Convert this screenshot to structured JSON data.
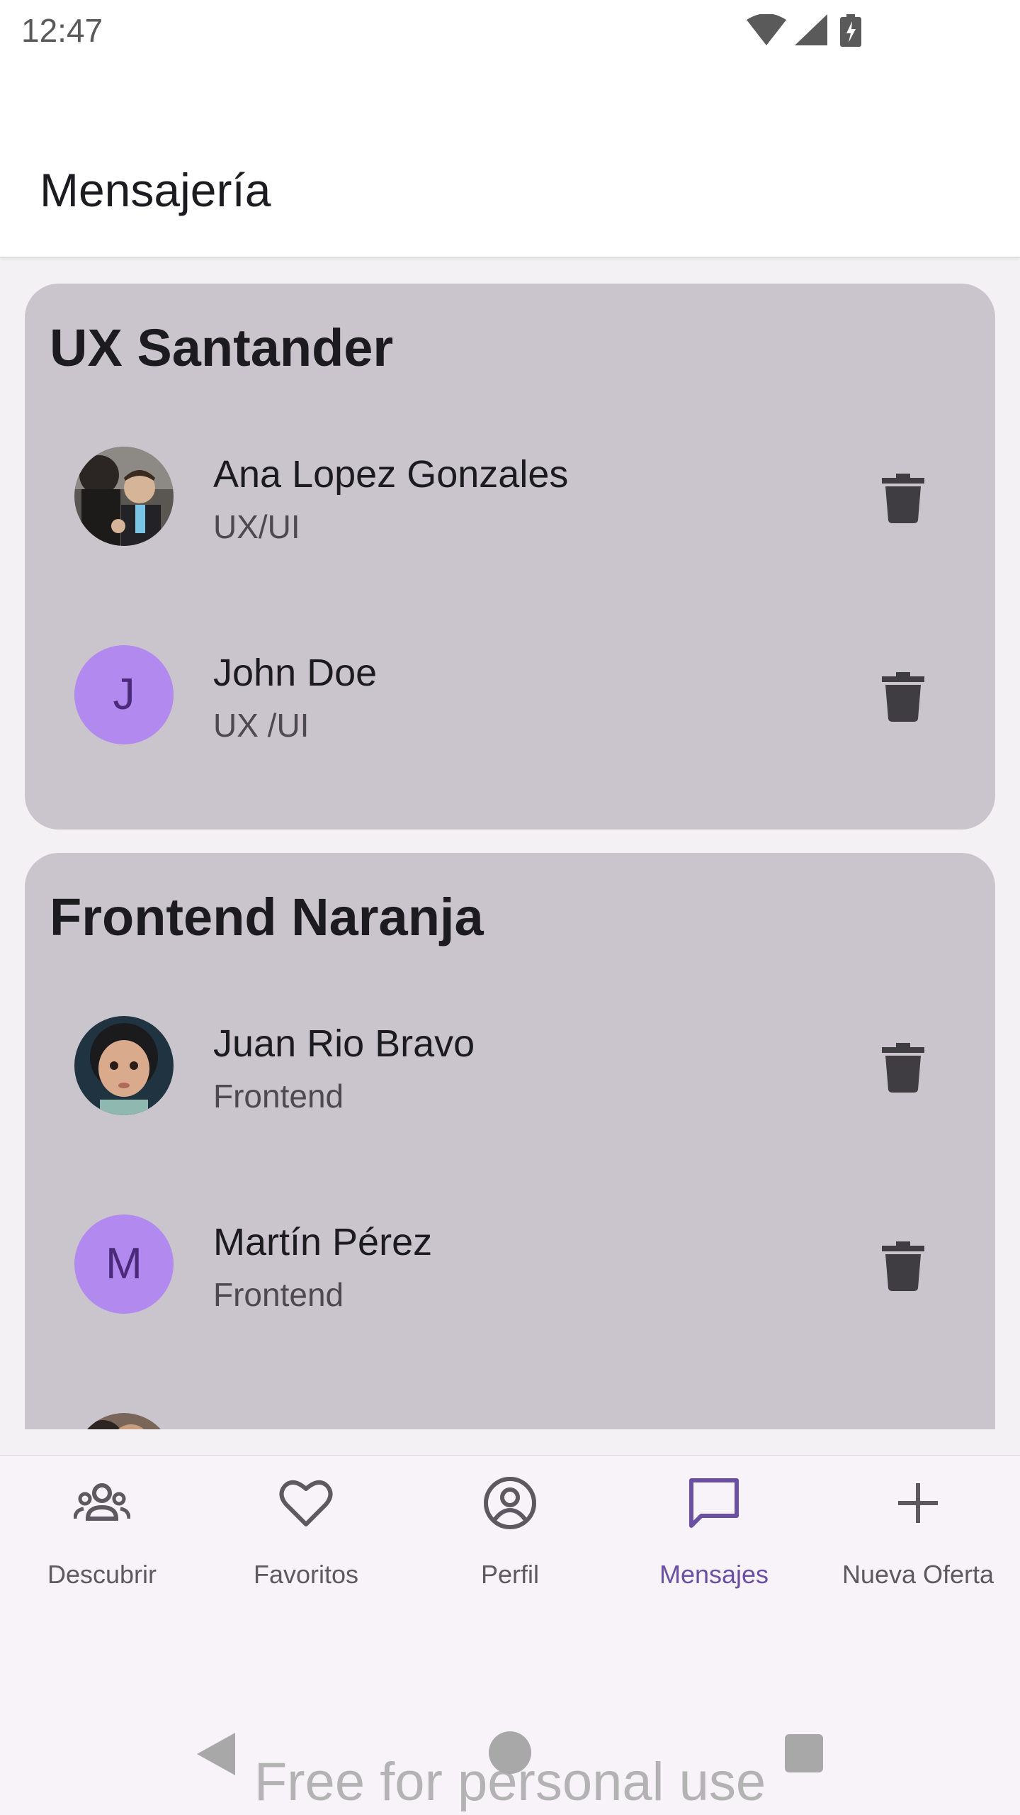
{
  "status_bar": {
    "time": "12:47"
  },
  "app_bar": {
    "title": "Mensajería"
  },
  "groups": [
    {
      "title": "UX Santander",
      "contacts": [
        {
          "name": "Ana Lopez Gonzales",
          "role": "UX/UI",
          "avatar": "photo"
        },
        {
          "name": "John Doe",
          "role": "UX /UI",
          "avatar_letter": "J"
        }
      ]
    },
    {
      "title": "Frontend Naranja",
      "contacts": [
        {
          "name": "Juan Rio Bravo",
          "role": "Frontend",
          "avatar": "photo"
        },
        {
          "name": "Martín Pérez",
          "role": "Frontend",
          "avatar_letter": "M"
        }
      ]
    }
  ],
  "bottom_nav": {
    "items": [
      {
        "label": "Descubrir",
        "icon": "people-icon"
      },
      {
        "label": "Favoritos",
        "icon": "heart-icon"
      },
      {
        "label": "Perfil",
        "icon": "account-circle-icon"
      },
      {
        "label": "Mensajes",
        "icon": "chat-icon"
      },
      {
        "label": "Nueva Oferta",
        "icon": "plus-icon"
      }
    ],
    "active": "Mensajes"
  },
  "watermark": "Free for personal use",
  "colors": {
    "card": "#cac5cc",
    "avatar_letter_bg": "#b289ee",
    "accent": "#6a4fa3",
    "delete_icon": "#3f3d42"
  }
}
